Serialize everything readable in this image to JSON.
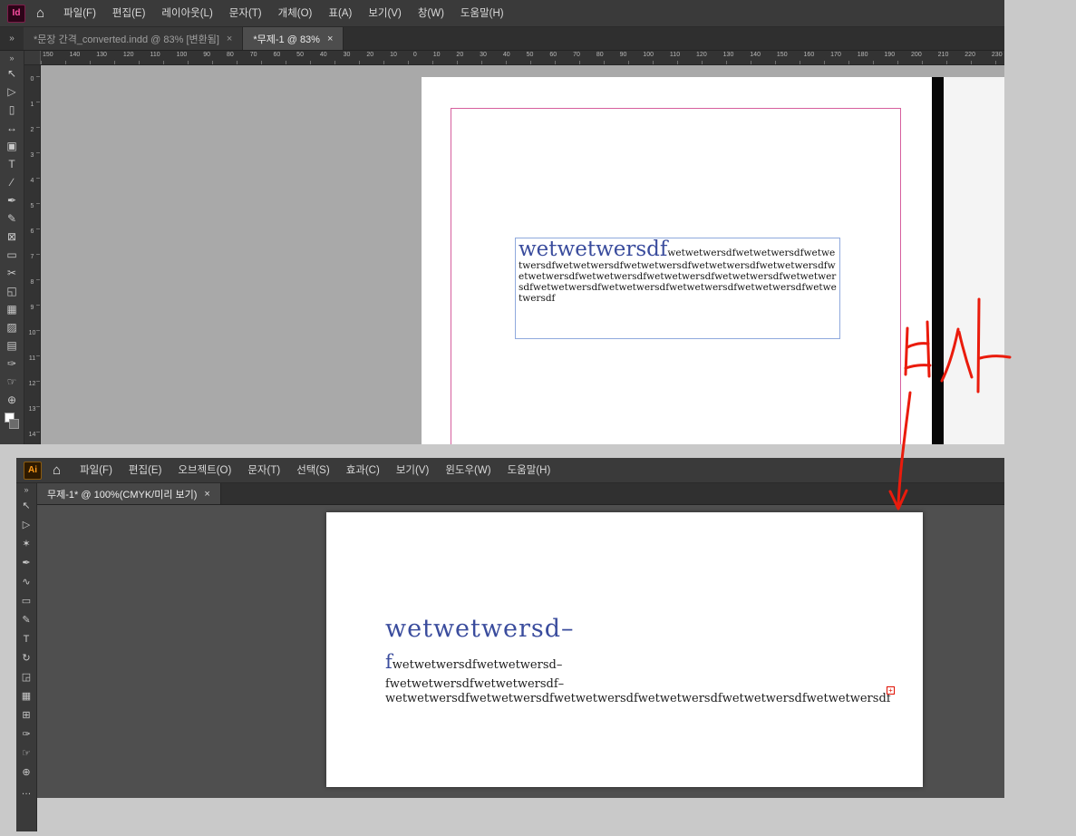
{
  "ui": {
    "home_glyph": "⌂",
    "chevrons": "»"
  },
  "colors": {
    "indesign_brand": "#ff4fa3",
    "illustrator_brand": "#ff9c1a",
    "heading_blue": "#3a4c9d",
    "margin_guide_pink": "#d65f9e",
    "text_frame_blue": "#8fa9dd",
    "annotation_red": "#ea1b0c",
    "overset_red": "#e01000"
  },
  "indesign": {
    "logo_label": "Id",
    "menu_items": [
      "파일(F)",
      "편집(E)",
      "레이아웃(L)",
      "문자(T)",
      "개체(O)",
      "표(A)",
      "보기(V)",
      "창(W)",
      "도움말(H)"
    ],
    "tabs": [
      {
        "label": "*문장 간격_converted.indd @ 83% [변환됨]",
        "close": "×",
        "active": false
      },
      {
        "label": "*무제-1 @ 83%",
        "close": "×",
        "active": true
      }
    ],
    "ruler_h": [
      "150",
      "140",
      "130",
      "120",
      "110",
      "100",
      "90",
      "80",
      "70",
      "60",
      "50",
      "40",
      "30",
      "20",
      "10",
      "0",
      "10",
      "20",
      "30",
      "40",
      "50",
      "60",
      "70",
      "80",
      "90",
      "100",
      "110",
      "120",
      "130",
      "140",
      "150",
      "160",
      "170",
      "180",
      "190",
      "200",
      "210",
      "220",
      "230"
    ],
    "ruler_v": [
      "0",
      "1",
      "2",
      "3",
      "4",
      "5",
      "6",
      "7",
      "8",
      "9",
      "10",
      "11",
      "12",
      "13",
      "14"
    ],
    "tools": [
      {
        "name": "selection-tool",
        "glyph": "↖"
      },
      {
        "name": "direct-selection-tool",
        "glyph": "▷"
      },
      {
        "name": "page-tool",
        "glyph": "▯"
      },
      {
        "name": "gap-tool",
        "glyph": "↔"
      },
      {
        "name": "content-collector-tool",
        "glyph": "▣"
      },
      {
        "name": "type-tool",
        "glyph": "T"
      },
      {
        "name": "line-tool",
        "glyph": "∕"
      },
      {
        "name": "pen-tool",
        "glyph": "✒"
      },
      {
        "name": "pencil-tool",
        "glyph": "✎"
      },
      {
        "name": "rectangle-frame-tool",
        "glyph": "⊠"
      },
      {
        "name": "rectangle-tool",
        "glyph": "▭"
      },
      {
        "name": "scissors-tool",
        "glyph": "✂"
      },
      {
        "name": "free-transform-tool",
        "glyph": "◱"
      },
      {
        "name": "gradient-swatch-tool",
        "glyph": "▦"
      },
      {
        "name": "gradient-feather-tool",
        "glyph": "▨"
      },
      {
        "name": "note-tool",
        "glyph": "▤"
      },
      {
        "name": "eyedropper-tool",
        "glyph": "✑"
      },
      {
        "name": "hand-tool",
        "glyph": "☞"
      },
      {
        "name": "zoom-tool",
        "glyph": "⊕"
      }
    ],
    "document": {
      "heading": "wetwetwersdf",
      "body": "wetwetwersdfwetwetwersdfwetwetwersdfwetwetwersdfwetwetwersdfwetwetwersdfwetwetwersdfwetwetwersdfwetwetwersdfwetwetwersdfwetwetwersdfwetwetwersdfwetwetwersdfwetwetwersdfwetwetwersdfwetwetwersdfwetwetwersdf"
    }
  },
  "illustrator": {
    "logo_label": "Ai",
    "menu_items": [
      "파일(F)",
      "편집(E)",
      "오브젝트(O)",
      "문자(T)",
      "선택(S)",
      "효과(C)",
      "보기(V)",
      "윈도우(W)",
      "도움말(H)"
    ],
    "tab": {
      "label": "무제-1* @ 100%(CMYK/미리 보기)",
      "close": "×"
    },
    "tools": [
      {
        "name": "selection-tool",
        "glyph": "↖"
      },
      {
        "name": "direct-selection-tool",
        "glyph": "▷"
      },
      {
        "name": "magic-wand-tool",
        "glyph": "✶"
      },
      {
        "name": "pen-tool",
        "glyph": "✒"
      },
      {
        "name": "curvature-tool",
        "glyph": "∿"
      },
      {
        "name": "rectangle-tool",
        "glyph": "▭"
      },
      {
        "name": "paintbrush-tool",
        "glyph": "✎"
      },
      {
        "name": "type-tool",
        "glyph": "T"
      },
      {
        "name": "rotate-tool",
        "glyph": "↻"
      },
      {
        "name": "scale-tool",
        "glyph": "◲"
      },
      {
        "name": "gradient-tool",
        "glyph": "▦"
      },
      {
        "name": "mesh-tool",
        "glyph": "⊞"
      },
      {
        "name": "eyedropper-tool",
        "glyph": "✑"
      },
      {
        "name": "hand-tool",
        "glyph": "☞"
      },
      {
        "name": "zoom-tool",
        "glyph": "⊕"
      },
      {
        "name": "edit-toolbar-button",
        "glyph": "…"
      }
    ],
    "artboard": {
      "heading": "wetwetwersd–",
      "line2_big": "f",
      "line2_rest": "wetwetwersdfwetwetwersd–",
      "line3": "fwetwetwersdfwetwetwersdf–",
      "line4": "wetwetwersdfwetwetwersdfwetwetwersdfwetwetwersdfwetwetwersdfwetwetwersdf",
      "overflow_glyph": "+"
    }
  },
  "annotation": {
    "text": "복사",
    "color": "#ea1b0c"
  }
}
